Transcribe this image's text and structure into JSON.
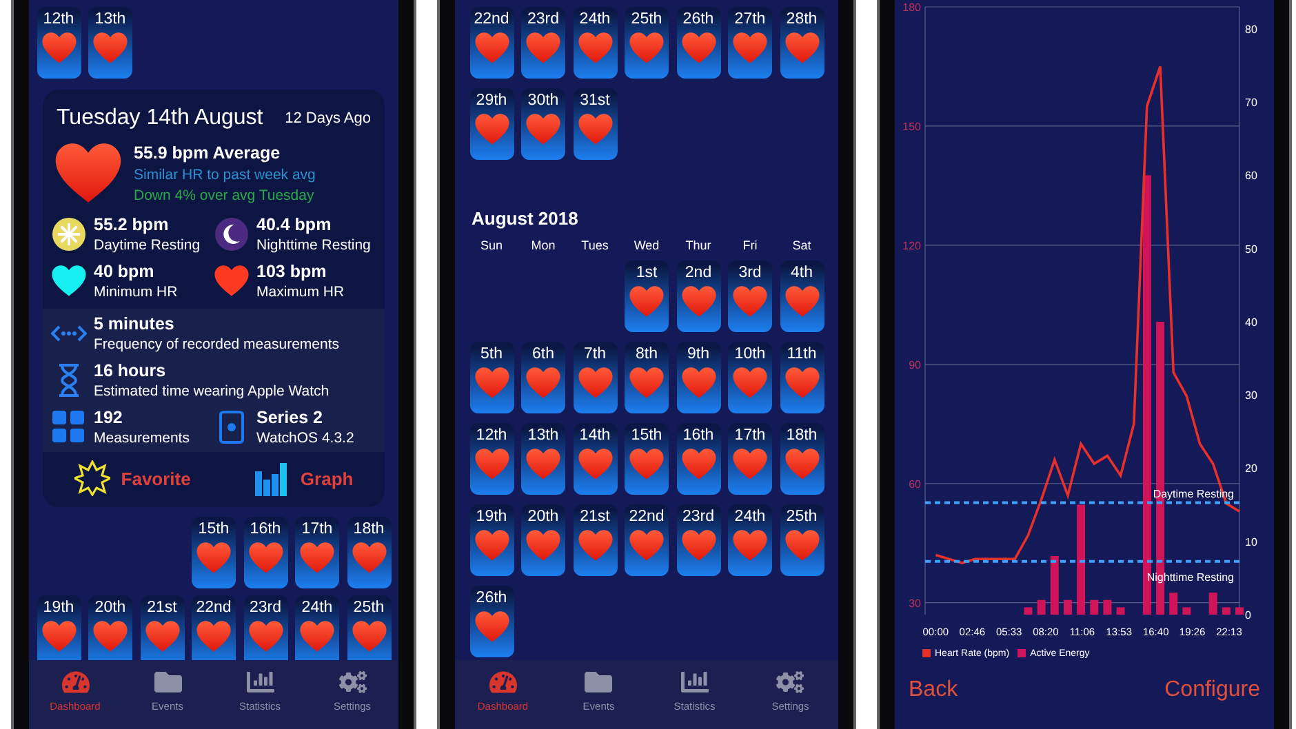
{
  "dashboard_screen": {
    "calendar_before": [
      [
        "12th",
        "13th"
      ]
    ],
    "detail_card": {
      "title": "Tuesday 14th August",
      "ago": "12 Days Ago",
      "average": "55.9 bpm Average",
      "comparisons": [
        {
          "text": "Similar HR to past week avg",
          "color": "#2f8fd0"
        },
        {
          "text": "Down 4% over avg Tuesday",
          "color": "#2aa84a"
        }
      ],
      "stats": [
        {
          "kind": "sun",
          "value": "55.2 bpm",
          "label": "Daytime Resting"
        },
        {
          "kind": "moon",
          "value": "40.4 bpm",
          "label": "Nighttime Resting"
        },
        {
          "kind": "min-heart",
          "value": "40 bpm",
          "label": "Minimum HR"
        },
        {
          "kind": "max-heart",
          "value": "103 bpm",
          "label": "Maximum HR"
        }
      ],
      "details": [
        {
          "kind": "frequency",
          "value": "5 minutes",
          "label": "Frequency of recorded measurements"
        },
        {
          "kind": "hourglass",
          "value": "16 hours",
          "label": "Estimated time wearing Apple Watch"
        }
      ],
      "device": [
        {
          "kind": "grid",
          "value": "192",
          "label": "Measurements"
        },
        {
          "kind": "watch",
          "value": "Series 2",
          "label": "WatchOS 4.3.2"
        }
      ],
      "actions": [
        {
          "kind": "star",
          "label": "Favorite"
        },
        {
          "kind": "graph",
          "label": "Graph"
        }
      ]
    },
    "calendar_after": [
      [
        "15th",
        "16th",
        "17th",
        "18th"
      ],
      [
        "19th",
        "20th",
        "21st",
        "22nd",
        "23rd",
        "24th",
        "25th"
      ]
    ],
    "tab_bar": [
      {
        "kind": "gauge",
        "label": "Dashboard",
        "selected": true
      },
      {
        "kind": "folder",
        "label": "Events",
        "selected": false
      },
      {
        "kind": "chart",
        "label": "Statistics",
        "selected": false
      },
      {
        "kind": "gears",
        "label": "Settings",
        "selected": false
      }
    ]
  },
  "calendar_screen": {
    "rows_before": [
      [
        "22nd",
        "23rd",
        "24th",
        "25th",
        "26th",
        "27th",
        "28th"
      ],
      [
        "29th",
        "30th",
        "31st"
      ]
    ],
    "month": "August 2018",
    "weekdays": [
      "Sun",
      "Mon",
      "Tues",
      "Wed",
      "Thur",
      "Fri",
      "Sat"
    ],
    "rows": [
      [
        null,
        null,
        null,
        "1st",
        "2nd",
        "3rd",
        "4th"
      ],
      [
        "5th",
        "6th",
        "7th",
        "8th",
        "9th",
        "10th",
        "11th"
      ],
      [
        "12th",
        "13th",
        "14th",
        "15th",
        "16th",
        "17th",
        "18th"
      ],
      [
        "19th",
        "20th",
        "21st",
        "22nd",
        "23rd",
        "24th",
        "25th"
      ],
      [
        "26th"
      ]
    ],
    "tab_bar": [
      {
        "kind": "gauge",
        "label": "Dashboard",
        "selected": true
      },
      {
        "kind": "folder",
        "label": "Events",
        "selected": false
      },
      {
        "kind": "chart",
        "label": "Statistics",
        "selected": false
      },
      {
        "kind": "gears",
        "label": "Settings",
        "selected": false
      }
    ]
  },
  "graph_screen": {
    "chart_data": {
      "type": "line",
      "x": [
        0,
        1,
        2,
        3,
        4,
        5,
        6,
        7,
        8,
        9,
        10,
        11,
        12,
        13,
        14,
        15,
        16,
        17,
        18,
        19,
        20,
        21,
        22,
        23
      ],
      "series": [
        {
          "name": "Heart Rate (bpm)",
          "color": "#e8302a",
          "values": [
            42,
            41,
            40,
            41,
            41,
            41,
            41,
            47,
            56,
            66,
            57,
            70,
            65,
            67,
            62,
            75,
            155,
            165,
            88,
            82,
            70,
            65,
            55,
            53
          ]
        },
        {
          "name": "Active Energy",
          "color": "#d0145a",
          "type": "bar",
          "axis": "y2",
          "values": [
            null,
            null,
            null,
            null,
            null,
            null,
            null,
            1,
            2,
            8,
            2,
            15,
            2,
            2,
            1,
            null,
            60,
            40,
            3,
            1,
            null,
            3,
            1,
            1
          ]
        }
      ],
      "xlim": [
        -0.8,
        23
      ],
      "ylim": [
        27,
        180
      ],
      "y2lim": [
        0,
        83
      ],
      "grid": true,
      "legend": "bottom",
      "xticks": [
        {
          "value": 0,
          "label": "00:00"
        },
        {
          "value": 2.77,
          "label": "02:46"
        },
        {
          "value": 5.55,
          "label": "05:33"
        },
        {
          "value": 8.33,
          "label": "08:20"
        },
        {
          "value": 11.1,
          "label": "11:06"
        },
        {
          "value": 13.88,
          "label": "13:53"
        },
        {
          "value": 16.67,
          "label": "16:40"
        },
        {
          "value": 19.43,
          "label": "19:26"
        },
        {
          "value": 22.22,
          "label": "22:13"
        }
      ],
      "yticks": [
        30,
        60,
        90,
        120,
        150,
        180
      ],
      "y2ticks": [
        0,
        10,
        20,
        30,
        40,
        50,
        60,
        70,
        80
      ],
      "ref_lines": [
        {
          "axis": "y",
          "value": 55.2,
          "label": "Daytime Resting"
        },
        {
          "axis": "y",
          "value": 40.4,
          "label": "Nighttime Resting"
        }
      ]
    },
    "buttons": [
      "Back",
      "Configure"
    ]
  }
}
